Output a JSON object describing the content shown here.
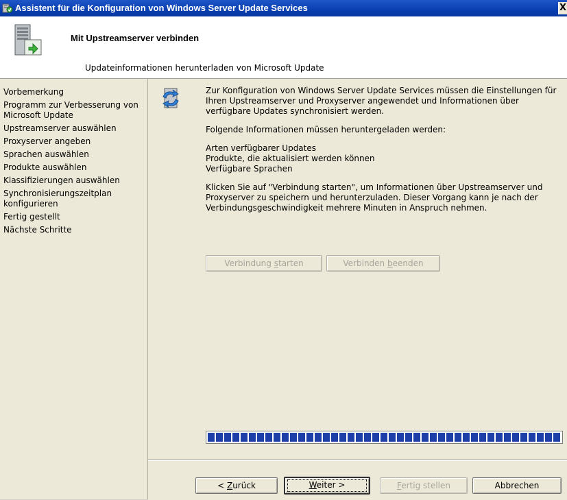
{
  "window": {
    "title": "Assistent für die Konfiguration von Windows Server Update Services",
    "close_glyph": "X"
  },
  "header": {
    "title": "Mit Upstreamserver verbinden",
    "subtitle": "Updateinformationen herunterladen von Microsoft Update"
  },
  "sidebar": {
    "items": [
      {
        "label": "Vorbemerkung"
      },
      {
        "label": "Programm zur Verbesserung von Microsoft Update"
      },
      {
        "label": "Upstreamserver auswählen"
      },
      {
        "label": "Proxyserver angeben"
      },
      {
        "label": "Sprachen auswählen"
      },
      {
        "label": "Produkte auswählen"
      },
      {
        "label": "Klassifizierungen auswählen"
      },
      {
        "label": "Synchronisierungszeitplan konfigurieren"
      },
      {
        "label": "Fertig gestellt"
      },
      {
        "label": "Nächste Schritte"
      }
    ]
  },
  "main": {
    "paragraph1": "Zur Konfiguration von Windows Server Update Services müssen die Einstellungen für Ihren Upstreamserver und Proxyserver angewendet und Informationen über verfügbare Updates synchronisiert werden.",
    "paragraph2": "Folgende Informationen müssen heruntergeladen werden:",
    "list": [
      "Arten verfügbarer Updates",
      "Produkte, die aktualisiert werden können",
      "Verfügbare Sprachen"
    ],
    "paragraph3": "Klicken Sie auf \"Verbindung starten\", um Informationen über Upstreamserver und Proxyserver zu speichern und herunterzuladen. Dieser Vorgang kann je nach der Verbindungsgeschwindigkeit mehrere Minuten in Anspruch nehmen.",
    "start_button": {
      "pre": "Verbindung ",
      "accel": "s",
      "post": "tarten"
    },
    "stop_button": {
      "pre": "Verbinden ",
      "accel": "b",
      "post": "eenden"
    },
    "progress_fraction": 1.0
  },
  "footer": {
    "back_button": {
      "pre": "< ",
      "accel": "Z",
      "post": "urück"
    },
    "next_button": {
      "pre": "",
      "accel": "W",
      "post": "eiter >"
    },
    "finish_button": {
      "pre": "",
      "accel": "F",
      "post": "ertig stellen"
    },
    "cancel_button": {
      "label": "Abbrechen"
    }
  },
  "colors": {
    "titlebar": "#0a3fb0",
    "progress_block": "#1e3fa8",
    "dialog_bg": "#ece9d8"
  }
}
